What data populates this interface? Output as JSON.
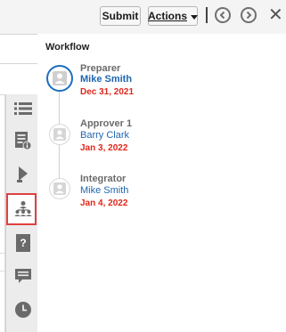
{
  "toolbar": {
    "submit_label": "Submit",
    "actions_label": "Actions",
    "prev_icon": "chevron-left-circle-icon",
    "next_icon": "chevron-right-circle-icon",
    "close_icon": "close-icon",
    "close_glyph": "✕"
  },
  "rail": {
    "items": [
      {
        "icon": "list-icon"
      },
      {
        "icon": "document-info-icon"
      },
      {
        "icon": "bell-icon"
      },
      {
        "icon": "hierarchy-workflow-icon",
        "selected": true
      },
      {
        "icon": "help-document-icon"
      },
      {
        "icon": "comment-icon"
      },
      {
        "icon": "clock-icon"
      }
    ]
  },
  "workflow": {
    "title": "Workflow",
    "steps": [
      {
        "role": "Preparer",
        "name": "Mike Smith",
        "date": "Dec 31, 2021",
        "current": true
      },
      {
        "role": "Approver 1",
        "name": "Barry Clark",
        "date": "Jan 3, 2022",
        "current": false
      },
      {
        "role": "Integrator",
        "name": "Mike Smith",
        "date": "Jan 4, 2022",
        "current": false
      }
    ]
  },
  "colors": {
    "accent_blue": "#1c6ec2",
    "date_red": "#e0271b",
    "selected_outline": "#e04141",
    "rail_bg": "#ececec"
  }
}
